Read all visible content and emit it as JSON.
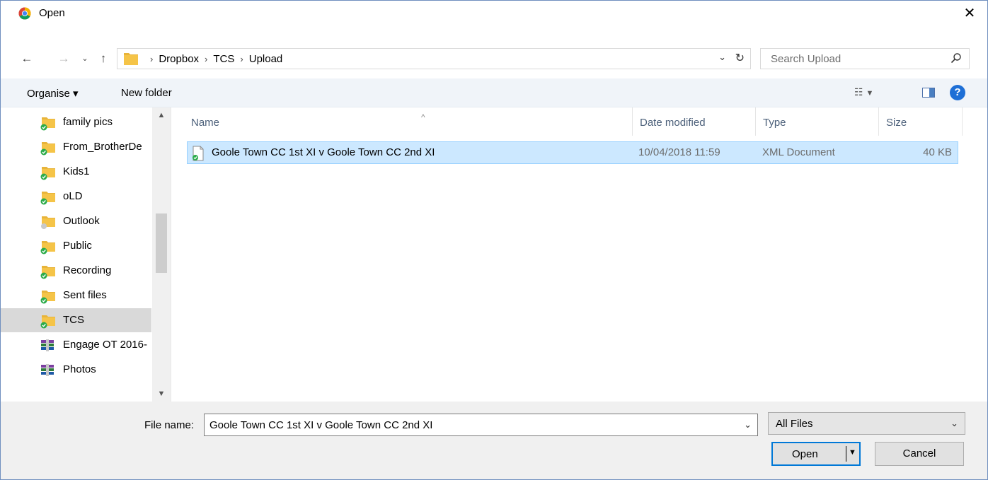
{
  "window": {
    "title": "Open"
  },
  "nav": {
    "path": [
      "Dropbox",
      "TCS",
      "Upload"
    ],
    "search_placeholder": "Search Upload"
  },
  "toolbar": {
    "organise_label": "Organise ▾",
    "new_folder_label": "New folder",
    "help_label": "?"
  },
  "sidebar": {
    "items": [
      {
        "label": "family pics",
        "icon": "folder-sync-icon"
      },
      {
        "label": "From_BrotherDe",
        "icon": "folder-sync-icon"
      },
      {
        "label": "Kids1",
        "icon": "folder-sync-icon"
      },
      {
        "label": "oLD",
        "icon": "folder-sync-icon"
      },
      {
        "label": "Outlook",
        "icon": "folder-icon"
      },
      {
        "label": "Public",
        "icon": "folder-sync-icon"
      },
      {
        "label": "Recording",
        "icon": "folder-sync-icon"
      },
      {
        "label": "Sent files",
        "icon": "folder-sync-icon"
      },
      {
        "label": "TCS",
        "icon": "folder-sync-icon",
        "selected": true
      },
      {
        "label": "Engage OT 2016-",
        "icon": "archive-icon"
      },
      {
        "label": "Photos",
        "icon": "archive-icon"
      }
    ]
  },
  "columns": {
    "name": "Name",
    "date": "Date modified",
    "type": "Type",
    "size": "Size"
  },
  "files": [
    {
      "name": "Goole Town CC 1st XI v Goole Town CC 2nd XI",
      "date": "10/04/2018 11:59",
      "type": "XML Document",
      "size": "40 KB"
    }
  ],
  "footer": {
    "file_name_label": "File name:",
    "file_name_value": "Goole Town CC 1st XI v Goole Town CC 2nd XI",
    "file_type": "All Files",
    "open_label": "Open",
    "cancel_label": "Cancel"
  },
  "colors": {
    "accent": "#0078d7",
    "selection": "#cce8ff",
    "folder": "#f5c448"
  }
}
